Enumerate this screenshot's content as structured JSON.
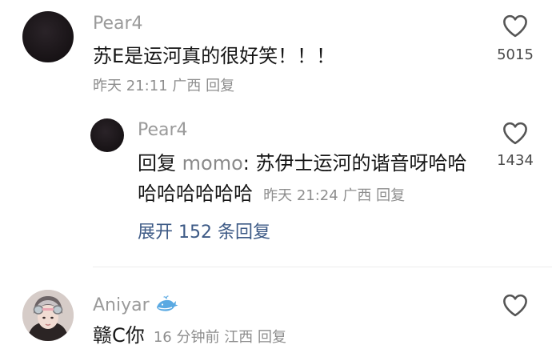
{
  "comment1": {
    "username": "Pear4",
    "text": "苏E是运河真的很好笑！！！",
    "date": "昨天",
    "time": "21:11",
    "location": "广西",
    "reply_label": "回复",
    "likes": "5015"
  },
  "reply1": {
    "username": "Pear4",
    "reply_prefix": "回复",
    "reply_target": "momo",
    "text_line1": ": 苏伊士运河的谐音呀哈哈",
    "text_line2": "哈哈哈哈哈哈",
    "date": "昨天",
    "time": "21:24",
    "location": "广西",
    "reply_label": "回复",
    "likes": "1434"
  },
  "expand": {
    "label": "展开 152 条回复"
  },
  "comment2": {
    "username": "Aniyar",
    "badge_icon": "whale-icon",
    "text": "赣C你",
    "age": "16 分钟前",
    "location": "江西",
    "reply_label": "回复"
  },
  "icons": {
    "like": "heart-outline-icon"
  },
  "colors": {
    "username": "#9a9a9a",
    "body_text": "#161616",
    "meta": "#8e8e8e",
    "expand_link": "#3d5a86",
    "badge": "#4aa3df"
  }
}
